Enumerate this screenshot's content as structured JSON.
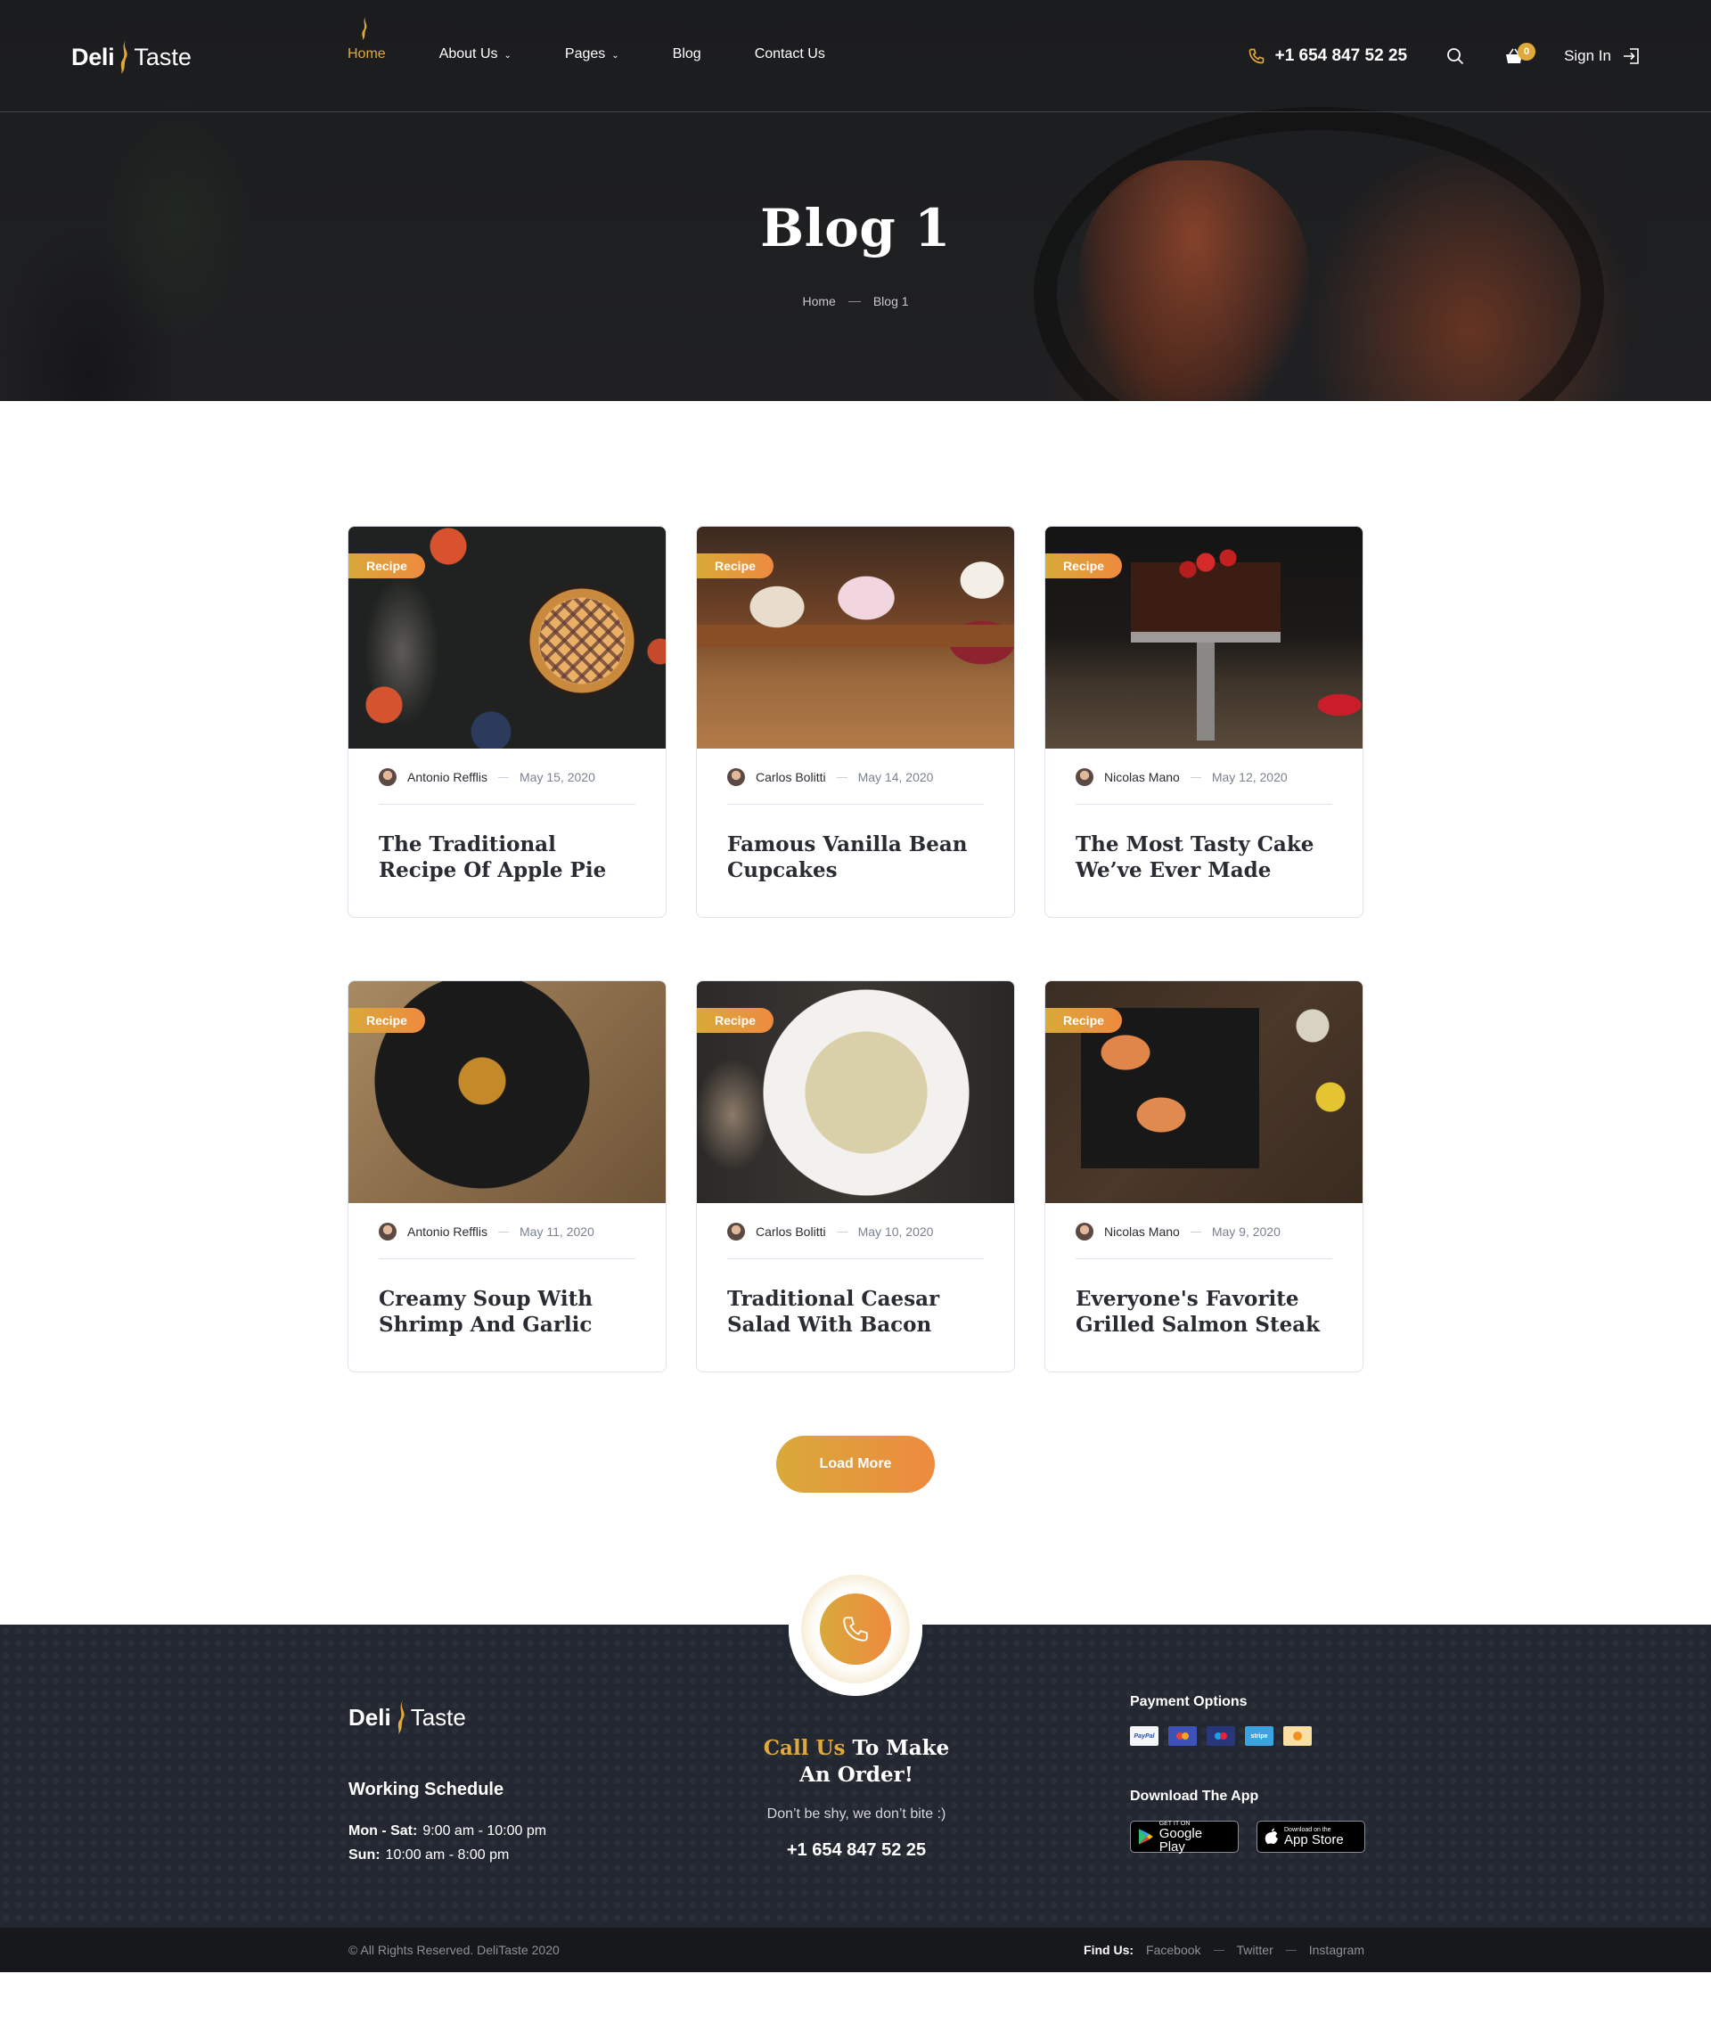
{
  "brand": {
    "name_part1": "Deli",
    "name_part2": "Taste",
    "accent_color": "#e0a93b",
    "gradient_start": "#d9a93a",
    "gradient_end": "#ee8a3f"
  },
  "nav": {
    "items": [
      {
        "label": "Home",
        "active": true,
        "has_dropdown": false
      },
      {
        "label": "About Us",
        "active": false,
        "has_dropdown": true
      },
      {
        "label": "Pages",
        "active": false,
        "has_dropdown": true
      },
      {
        "label": "Blog",
        "active": false,
        "has_dropdown": false
      },
      {
        "label": "Contact Us",
        "active": false,
        "has_dropdown": false
      }
    ],
    "phone": "+1 654 847 52 25",
    "cart_count": "0",
    "signin_label": "Sign In",
    "icons": {
      "phone": "phone-icon",
      "search": "search-icon",
      "cart": "basket-icon",
      "signin": "sign-in-icon"
    }
  },
  "hero": {
    "title": "Blog 1",
    "breadcrumb": [
      "Home",
      "Blog 1"
    ]
  },
  "posts": [
    {
      "tag": "Recipe",
      "author": "Antonio Refflis",
      "date": "May 15, 2020",
      "title": "The Traditional Recipe Of Apple Pie",
      "image": "apple-pie"
    },
    {
      "tag": "Recipe",
      "author": "Carlos Bolitti",
      "date": "May 14, 2020",
      "title": "Famous Vanilla Bean Cupcakes",
      "image": "cupcakes"
    },
    {
      "tag": "Recipe",
      "author": "Nicolas Mano",
      "date": "May 12, 2020",
      "title": "The Most Tasty Cake We’ve Ever Made",
      "image": "chocolate-cake"
    },
    {
      "tag": "Recipe",
      "author": "Antonio Refflis",
      "date": "May 11, 2020",
      "title": "Creamy Soup With Shrimp And Garlic",
      "image": "shrimp-soup"
    },
    {
      "tag": "Recipe",
      "author": "Carlos Bolitti",
      "date": "May 10, 2020",
      "title": "Traditional Caesar Salad With Bacon",
      "image": "caesar-salad"
    },
    {
      "tag": "Recipe",
      "author": "Nicolas Mano",
      "date": "May 9, 2020",
      "title": "Everyone's Favorite Grilled Salmon Steak",
      "image": "salmon-steak"
    }
  ],
  "load_more_label": "Load More",
  "footer": {
    "schedule_title": "Working Schedule",
    "schedule": [
      {
        "days": "Mon - Sat:",
        "hours": "9:00 am - 10:00 pm"
      },
      {
        "days": "Sun:",
        "hours": "10:00 am - 8:00 pm"
      }
    ],
    "cta_accent": "Call Us",
    "cta_rest": "To Make",
    "cta_line2": "An Order!",
    "cta_sub": "Don’t be shy, we don’t bite :)",
    "phone": "+1 654 847 52 25",
    "payment_title": "Payment Options",
    "payments": [
      "PayPal",
      "Mastercard",
      "Maestro",
      "stripe",
      "Bitcoin"
    ],
    "app_title": "Download The App",
    "stores": [
      {
        "small": "GET IT ON",
        "big": "Google Play"
      },
      {
        "small": "Download on the",
        "big": "App Store"
      }
    ],
    "copyright": "© All Rights Reserved. DeliTaste 2020",
    "find_us_label": "Find Us:",
    "social": [
      "Facebook",
      "Twitter",
      "Instagram"
    ]
  }
}
